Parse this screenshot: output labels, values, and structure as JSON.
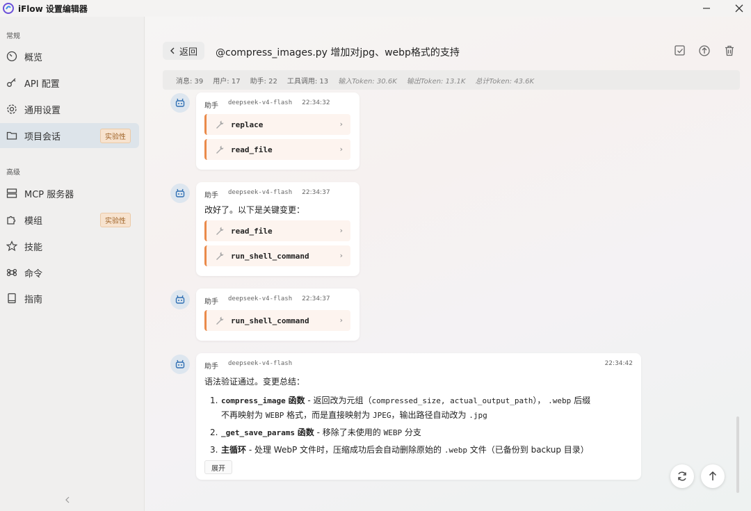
{
  "app": {
    "title": "iFlow 设置编辑器"
  },
  "sidebar": {
    "sections": [
      {
        "label": "常规"
      },
      {
        "label": "高级"
      }
    ],
    "items": [
      {
        "label": "概览",
        "icon": "gauge-icon"
      },
      {
        "label": "API 配置",
        "icon": "key-icon"
      },
      {
        "label": "通用设置",
        "icon": "gear-icon"
      },
      {
        "label": "项目会话",
        "icon": "folder-icon",
        "badge": "实验性",
        "active": true
      },
      {
        "label": "MCP 服务器",
        "icon": "server-icon"
      },
      {
        "label": "模组",
        "icon": "puzzle-icon",
        "badge": "实验性"
      },
      {
        "label": "技能",
        "icon": "star-icon"
      },
      {
        "label": "命令",
        "icon": "command-icon"
      },
      {
        "label": "指南",
        "icon": "book-icon"
      }
    ]
  },
  "header": {
    "back_label": "返回",
    "title": "@compress_images.py 增加对jpg、webp格式的支持"
  },
  "stats": {
    "messages": "消息: 39",
    "users": "用户: 17",
    "assistant": "助手: 22",
    "tool_calls": "工具调用: 13",
    "input_tokens": "输入Token: 30.6K",
    "output_tokens": "输出Token: 13.1K",
    "total_tokens": "总计Token: 43.6K"
  },
  "messages": [
    {
      "role": "助手",
      "model": "deepseek-v4-flash",
      "time": "22:34:32",
      "tools": [
        "replace",
        "read_file"
      ]
    },
    {
      "role": "助手",
      "model": "deepseek-v4-flash",
      "time": "22:34:37",
      "text": "改好了。以下是关键变更：",
      "tools": [
        "read_file",
        "run_shell_command"
      ]
    },
    {
      "role": "助手",
      "model": "deepseek-v4-flash",
      "time": "22:34:37",
      "tools": [
        "run_shell_command"
      ]
    },
    {
      "role": "助手",
      "model": "deepseek-v4-flash",
      "time": "22:34:42",
      "text": "语法验证通过。变更总结：",
      "list": [
        {
          "n": "1.",
          "code": "compress_image",
          "bold": "函数",
          "a": " - 返回改为元组（",
          "c1": "compressed_size, actual_output_path",
          "b": "）， ",
          "c2": ".webp",
          "d": " 后缀",
          "e": "不再映射为 ",
          "c3": "WEBP",
          "f": " 格式，而是直接映射为 ",
          "c4": "JPEG",
          "g": "，输出路径自动改为 ",
          "c5": ".jpg"
        },
        {
          "n": "2.",
          "code": "_get_save_params",
          "bold": "函数",
          "a": " - 移除了未使用的 ",
          "c1": "WEBP",
          "b": " 分支"
        },
        {
          "n": "3.",
          "bold": "主循环",
          "a": " - 处理 WebP 文件时，压缩成功后会自动删除原始的 ",
          "c1": ".webp",
          "b": " 文件（已备份到 backup 目录）"
        }
      ],
      "expand_label": "展开"
    }
  ]
}
